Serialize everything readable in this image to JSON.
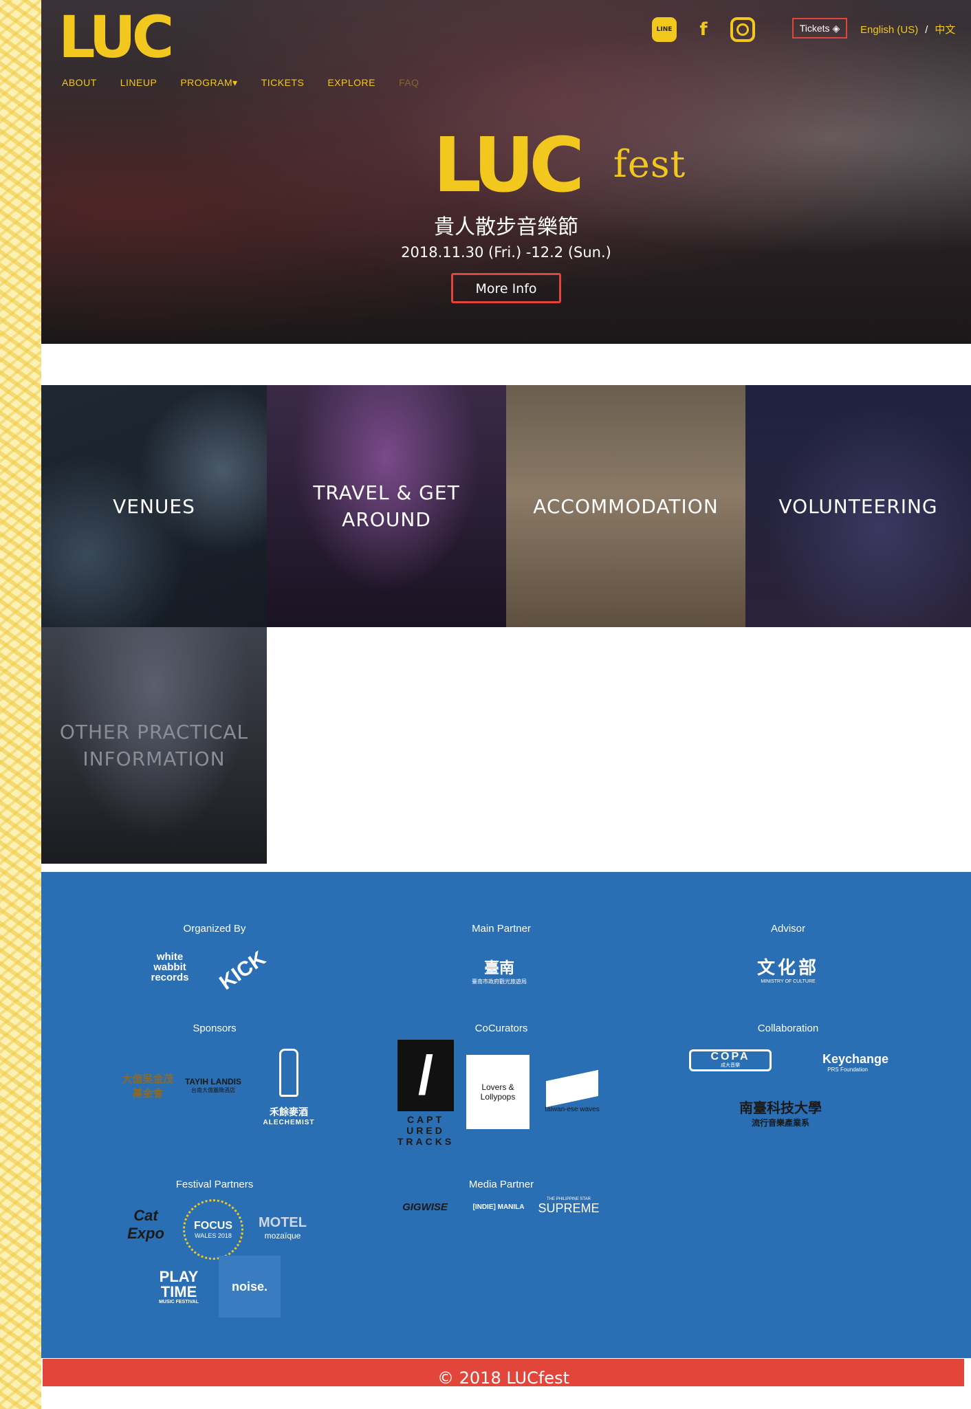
{
  "header": {
    "nav": [
      "ABOUT",
      "LINEUP",
      "PROGRAM",
      "TICKETS",
      "EXPLORE",
      "FAQ"
    ],
    "tickets_label": "Tickets",
    "lang_en": "English (US)",
    "lang_sep": "/",
    "lang_zh": "中文",
    "logo": "LUC"
  },
  "hero": {
    "logo_main": "LUC",
    "logo_fest": "fest",
    "subtitle": "貴人散步音樂節",
    "dates": "2018.11.30 (Fri.) -12.2 (Sun.)",
    "button": "More Info"
  },
  "tiles": [
    "VENUES",
    "TRAVEL & GET AROUND",
    "ACCOMMODATION",
    "VOLUNTEERING",
    "OTHER PRACTICAL INFORMATION"
  ],
  "partners": {
    "organized_by": "Organized By",
    "main_partner": "Main Partner",
    "advisor": "Advisor",
    "sponsors": "Sponsors",
    "cocurators": "CoCurators",
    "collaboration": "Collaboration",
    "festival_partners": "Festival Partners",
    "media_partner": "Media Partner",
    "logos": {
      "white_rabbit": "white wabbit records",
      "kick": "KICK",
      "tainan": "臺南",
      "tainan_sub": "臺南市政府觀光旅遊局",
      "moc": "文化部",
      "moc_sub": "MINISTRY OF CULTURE",
      "sponsor1": "大億吳金茂 基金會",
      "sponsor2": "TAYIH LANDIS",
      "sponsor2_sub": "台南大億麗緻酒店",
      "sponsor3": "禾餘麥酒",
      "sponsor3_sub": "ALECHEMIST",
      "captured": "CAPT URED TRACKS",
      "lovers": "Lovers & Lollypops",
      "waves": "taiwan-ese waves",
      "copa": "COPA",
      "copa_sub": "成大音樂",
      "keychange": "Keychange",
      "keychange_sub": "PRS Foundation",
      "stust": "南臺科技大學",
      "stust_sub": "流行音樂產業系",
      "catexpo": "Cat Expo",
      "focus": "FOCUS",
      "focus_sub": "WALES 2018",
      "motel": "MOTEL",
      "motel_sub": "mozaïque",
      "playtime": "PLAY TIME",
      "playtime_sub": "MUSIC FESTIVAL",
      "noise": "noise.",
      "gigwise": "GIGWISE",
      "indie": "[INDIE] MANILA",
      "supreme": "SUPREME",
      "supreme_sub": "THE PHILIPPINE STAR"
    }
  },
  "footer": {
    "copyright": "© 2018 LUCfest"
  },
  "colors": {
    "yellow": "#f2c81f",
    "red": "#e2453a",
    "blue": "#2a6eb4"
  }
}
